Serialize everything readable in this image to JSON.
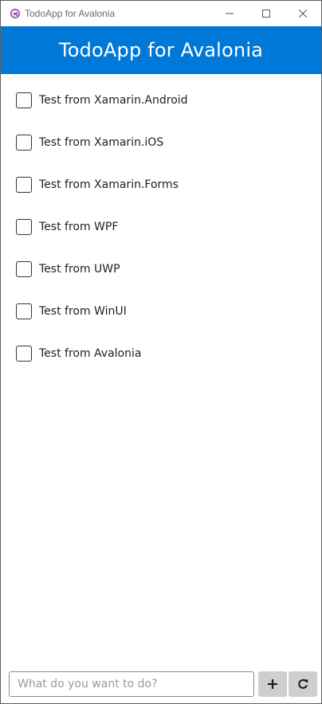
{
  "window": {
    "title": "TodoApp for Avalonia",
    "icon": "avalonia-logo-icon",
    "controls": [
      "minimize-icon",
      "maximize-icon",
      "close-icon"
    ]
  },
  "header": {
    "title": "TodoApp for Avalonia",
    "background": "#0078d7"
  },
  "todos": [
    {
      "label": "Test from Xamarin.Android",
      "checked": false
    },
    {
      "label": "Test from Xamarin.iOS",
      "checked": false
    },
    {
      "label": "Test from Xamarin.Forms",
      "checked": false
    },
    {
      "label": "Test from WPF",
      "checked": false
    },
    {
      "label": "Test from UWP",
      "checked": false
    },
    {
      "label": "Test from WinUI",
      "checked": false
    },
    {
      "label": "Test from Avalonia",
      "checked": false
    }
  ],
  "input": {
    "placeholder": "What do you want to do?",
    "value": ""
  },
  "buttons": {
    "add_icon": "plus-icon",
    "refresh_icon": "refresh-icon"
  }
}
